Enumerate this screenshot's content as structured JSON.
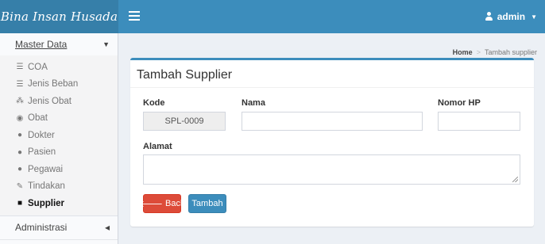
{
  "header": {
    "logo": "Bina Insan Husada",
    "user": "admin"
  },
  "sidebar": {
    "master_label": "Master Data",
    "items": [
      {
        "label": "COA",
        "icon": "list-icon",
        "glyph": "☰"
      },
      {
        "label": "Jenis Beban",
        "icon": "list-icon",
        "glyph": "☰"
      },
      {
        "label": "Jenis Obat",
        "icon": "cubes-icon",
        "glyph": "⁂"
      },
      {
        "label": "Obat",
        "icon": "binoculars-icon",
        "glyph": "◉"
      },
      {
        "label": "Dokter",
        "icon": "user-doctor-icon",
        "glyph": "●"
      },
      {
        "label": "Pasien",
        "icon": "user-icon",
        "glyph": "●"
      },
      {
        "label": "Pegawai",
        "icon": "user-icon",
        "glyph": "●"
      },
      {
        "label": "Tindakan",
        "icon": "pencil-icon",
        "glyph": "✎"
      },
      {
        "label": "Supplier",
        "icon": "truck-icon",
        "glyph": "■"
      }
    ],
    "admin_label": "Administrasi"
  },
  "breadcrumb": {
    "home": "Home",
    "separator": ">",
    "current": "Tambah supplier"
  },
  "form": {
    "title": "Tambah Supplier",
    "kode_label": "Kode",
    "kode_value": "SPL-0009",
    "nama_label": "Nama",
    "nama_value": "",
    "hp_label": "Nomor HP",
    "hp_value": "",
    "alamat_label": "Alamat",
    "back_label": "Back",
    "submit_label": "Tambah"
  },
  "colors": {
    "header": "#3c8dbc",
    "logo_bg": "#367fa9",
    "danger": "#dd4b39",
    "primary": "#3c8dbc"
  }
}
